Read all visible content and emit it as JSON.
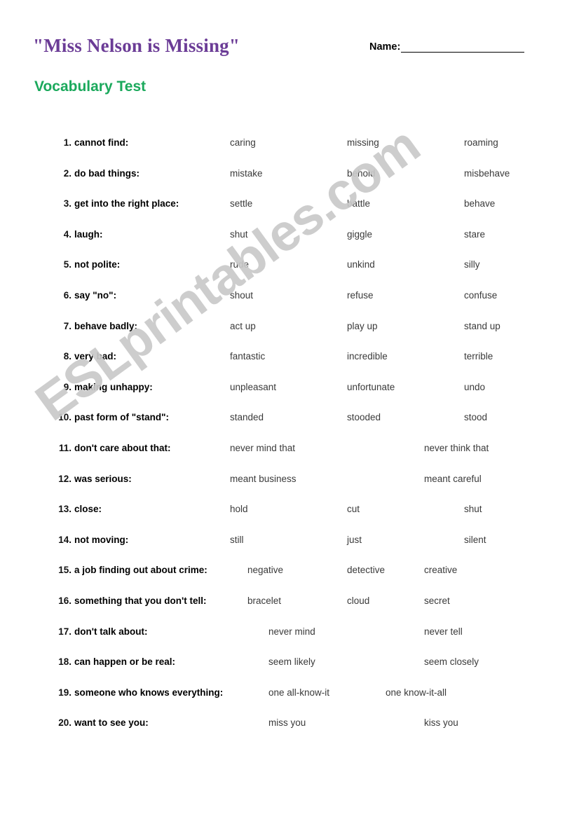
{
  "header": {
    "title": "\"Miss Nelson is Missing\"",
    "subtitle": "Vocabulary Test",
    "name_label": "Name:",
    "title_color": "#6b3c96",
    "subtitle_color": "#1ba95c"
  },
  "watermark": {
    "text": "ESLprintables.com",
    "color": "#c9c9c9"
  },
  "questions": [
    {
      "number": "1.",
      "prompt": "cannot find:",
      "options": [
        "caring",
        "missing",
        "roaming"
      ],
      "layout": "three-wide"
    },
    {
      "number": "2.",
      "prompt": "do bad things:",
      "options": [
        "mistake",
        "behold",
        "misbehave"
      ],
      "layout": "three-wide"
    },
    {
      "number": "3.",
      "prompt": "get into the right place:",
      "options": [
        "settle",
        "battle",
        "behave"
      ],
      "layout": "three-wide"
    },
    {
      "number": "4.",
      "prompt": "laugh:",
      "options": [
        "shut",
        "giggle",
        "stare"
      ],
      "layout": "three-wide"
    },
    {
      "number": "5.",
      "prompt": "not polite:",
      "options": [
        "rude",
        "unkind",
        "silly"
      ],
      "layout": "three-wide"
    },
    {
      "number": "6.",
      "prompt": "say \"no\":",
      "options": [
        "shout",
        "refuse",
        "confuse"
      ],
      "layout": "three-wide"
    },
    {
      "number": "7.",
      "prompt": "behave badly:",
      "options": [
        "act up",
        "play up",
        "stand up"
      ],
      "layout": "three-wide"
    },
    {
      "number": "8.",
      "prompt": "very bad:",
      "options": [
        "fantastic",
        "incredible",
        "terrible"
      ],
      "layout": "three-wide"
    },
    {
      "number": "9.",
      "prompt": "making unhappy:",
      "options": [
        "unpleasant",
        "unfortunate",
        "undo"
      ],
      "layout": "three-wide"
    },
    {
      "number": "10.",
      "prompt": "past form of \"stand\":",
      "options": [
        "standed",
        "stooded",
        "stood"
      ],
      "layout": "three-wide"
    },
    {
      "number": "11.",
      "prompt": "don't care about that:",
      "options": [
        "never mind that",
        "never think that"
      ],
      "layout": "two-wide"
    },
    {
      "number": "12.",
      "prompt": "was serious:",
      "options": [
        "meant business",
        "meant careful"
      ],
      "layout": "two-wide"
    },
    {
      "number": "13.",
      "prompt": "close:",
      "options": [
        "hold",
        "cut",
        "shut"
      ],
      "layout": "three-wide"
    },
    {
      "number": "14.",
      "prompt": "not moving:",
      "options": [
        "still",
        "just",
        "silent"
      ],
      "layout": "three-wide"
    },
    {
      "number": "15.",
      "prompt": "a job finding out about crime:",
      "options": [
        "negative",
        "detective",
        "creative"
      ],
      "layout": "three-narrow"
    },
    {
      "number": "16.",
      "prompt": "something that you don't tell:",
      "options": [
        "bracelet",
        "cloud",
        "secret"
      ],
      "layout": "three-narrow"
    },
    {
      "number": "17.",
      "prompt": "don't talk about:",
      "options": [
        "never mind",
        "never tell"
      ],
      "layout": "two-indent"
    },
    {
      "number": "18.",
      "prompt": "can happen or be real:",
      "options": [
        "seem likely",
        "seem closely"
      ],
      "layout": "two-indent"
    },
    {
      "number": "19.",
      "prompt": "someone who knows everything:",
      "options": [
        "one all-know-it",
        "one know-it-all"
      ],
      "layout": "two-close"
    },
    {
      "number": "20.",
      "prompt": "want to see you:",
      "options": [
        "miss you",
        "kiss you"
      ],
      "layout": "two-indent"
    }
  ]
}
